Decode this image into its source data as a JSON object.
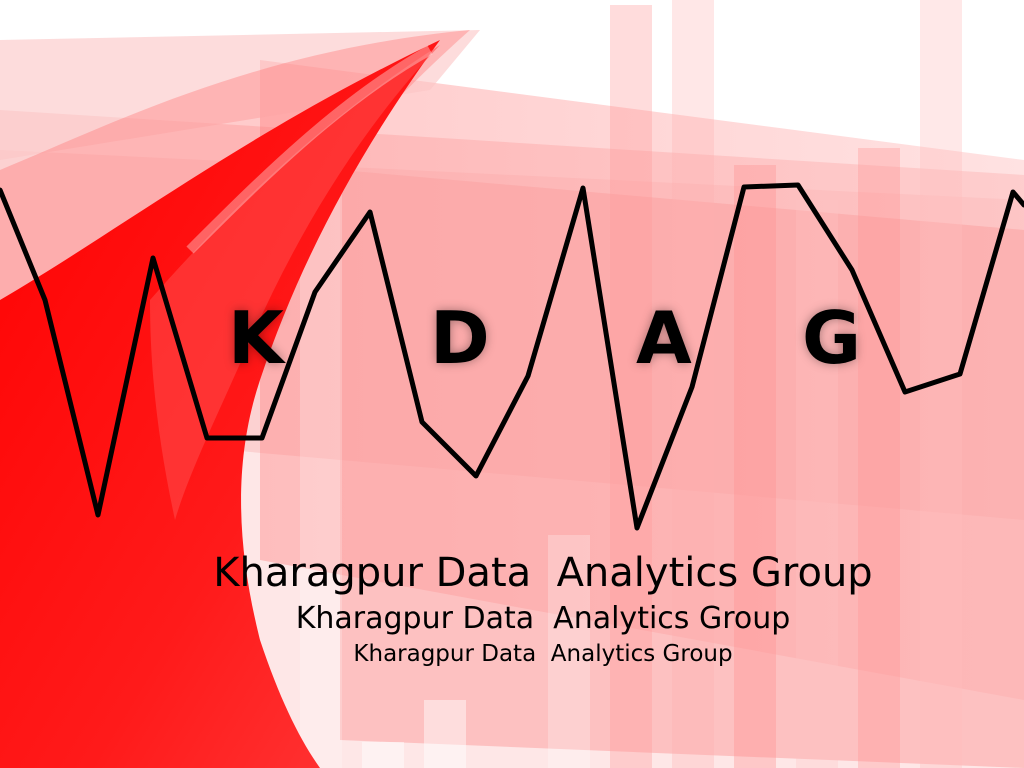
{
  "logo": {
    "letters": [
      "K",
      "D",
      "A",
      "G"
    ]
  },
  "taglines": [
    "Kharagpur Data  Analytics Group",
    "Kharagpur Data  Analytics Group",
    "Kharagpur Data  Analytics Group"
  ],
  "colors": {
    "primary_red": "#ff0000",
    "light_red": "#fca9a9",
    "pale_red": "#fdd9d9",
    "line": "#000000",
    "text": "#000000"
  },
  "decor": {
    "wave_line": "zigzag-line-graph",
    "background": "red-bar-chart-and-swoosh"
  }
}
